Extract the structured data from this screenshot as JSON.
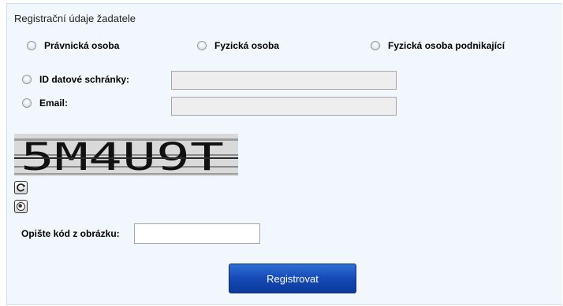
{
  "section": {
    "title": "Registrační údaje žadatele"
  },
  "person_types": [
    {
      "label": "Právnická osoba"
    },
    {
      "label": "Fyzická osoba"
    },
    {
      "label": "Fyzická osoba podnikající"
    }
  ],
  "identifiers": [
    {
      "label": "ID datové schránky:",
      "value": ""
    },
    {
      "label": "Email:",
      "value": ""
    }
  ],
  "captcha": {
    "text": "5M4U9T",
    "refresh_icon": "refresh-icon",
    "audio_icon": "speaker-icon"
  },
  "code": {
    "label": "Opište kód z obrázku:",
    "value": ""
  },
  "submit": {
    "label": "Registrovat"
  },
  "colors": {
    "panel_bg": "#f2f7fd",
    "panel_border": "#cfe0f2",
    "button_bg": "#1549b5",
    "field_bg": "#eeeeee"
  }
}
